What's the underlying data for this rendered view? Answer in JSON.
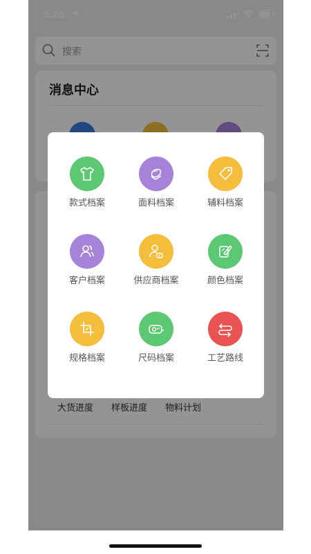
{
  "status": {
    "time": "5:28"
  },
  "search": {
    "placeholder": "搜索"
  },
  "message_center": {
    "title": "消息中心"
  },
  "progress_tabs": [
    "大货进度",
    "样板进度",
    "物料计划"
  ],
  "modal_items": [
    {
      "label": "款式档案",
      "icon": "shirt-icon",
      "color": "#5dc873"
    },
    {
      "label": "面料档案",
      "icon": "fabric-icon",
      "color": "#a683d9"
    },
    {
      "label": "辅料档案",
      "icon": "tag-icon",
      "color": "#f5bd3c"
    },
    {
      "label": "客户档案",
      "icon": "customers-icon",
      "color": "#a683d9"
    },
    {
      "label": "供应商档案",
      "icon": "supplier-icon",
      "color": "#f5bd3c"
    },
    {
      "label": "颜色档案",
      "icon": "palette-icon",
      "color": "#5dc873"
    },
    {
      "label": "规格档案",
      "icon": "crop-icon",
      "color": "#f5bd3c"
    },
    {
      "label": "尺码档案",
      "icon": "tape-measure-icon",
      "color": "#5dc873"
    },
    {
      "label": "工艺路线",
      "icon": "route-icon",
      "color": "#e95453"
    }
  ],
  "colors": {
    "green": "#5dc873",
    "purple": "#a683d9",
    "yellow": "#f5bd3c",
    "red": "#e95453",
    "blue": "#3b7ce0"
  }
}
